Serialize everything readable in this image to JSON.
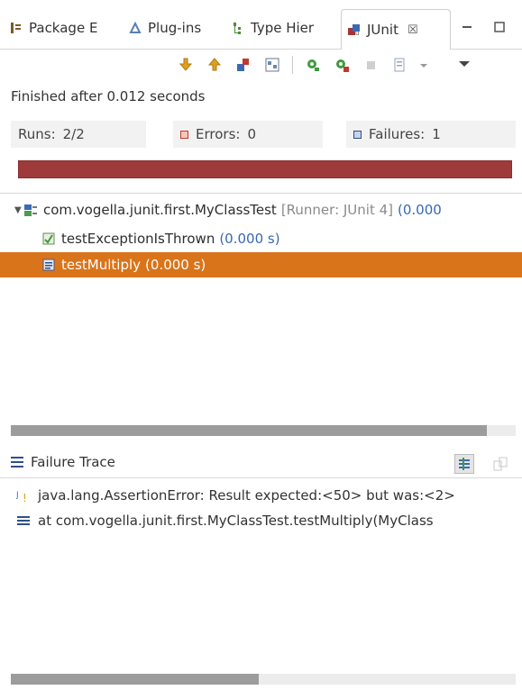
{
  "tabs": [
    {
      "label": "Package E",
      "icon": "package-explorer-icon"
    },
    {
      "label": "Plug-ins",
      "icon": "plugins-icon"
    },
    {
      "label": "Type Hier",
      "icon": "type-hierarchy-icon"
    },
    {
      "label": "JUnit",
      "icon": "junit-icon",
      "active": true,
      "close_glyph": "☒"
    }
  ],
  "toolbar": [
    "next-failure-icon",
    "previous-failure-icon",
    "failures-only-icon",
    "scroll-lock-icon",
    "rerun-icon",
    "rerun-failed-first-icon",
    "stop-icon",
    "history-icon",
    "dropdown-arrow-icon",
    "view-menu-icon"
  ],
  "status": {
    "finished": "Finished after 0.012 seconds"
  },
  "counters": {
    "runs_label": "Runs:",
    "runs_value": "2/2",
    "errors_label": "Errors:",
    "errors_value": "0",
    "failures_label": "Failures:",
    "failures_value": "1"
  },
  "progress": {
    "fraction": 1.0,
    "color": "#9e3a3a"
  },
  "tree": {
    "root": {
      "name": "com.vogella.junit.first.MyClassTest",
      "runner": "[Runner: JUnit 4]",
      "time": "(0.000"
    },
    "children": [
      {
        "name": "testExceptionIsThrown",
        "time": "(0.000 s)"
      },
      {
        "name": "testMultiply",
        "time": "(0.000 s)",
        "selected": true
      }
    ]
  },
  "trace": {
    "title": "Failure Trace",
    "lines": [
      "java.lang.AssertionError: Result expected:<50> but was:<2>",
      "at com.vogella.junit.first.MyClassTest.testMultiply(MyClass"
    ]
  },
  "colors": {
    "selection": "#d9741a",
    "failure_bar": "#9e3a3a",
    "error_marker": "#c0392b",
    "failure_marker": "#2f4f8a"
  }
}
